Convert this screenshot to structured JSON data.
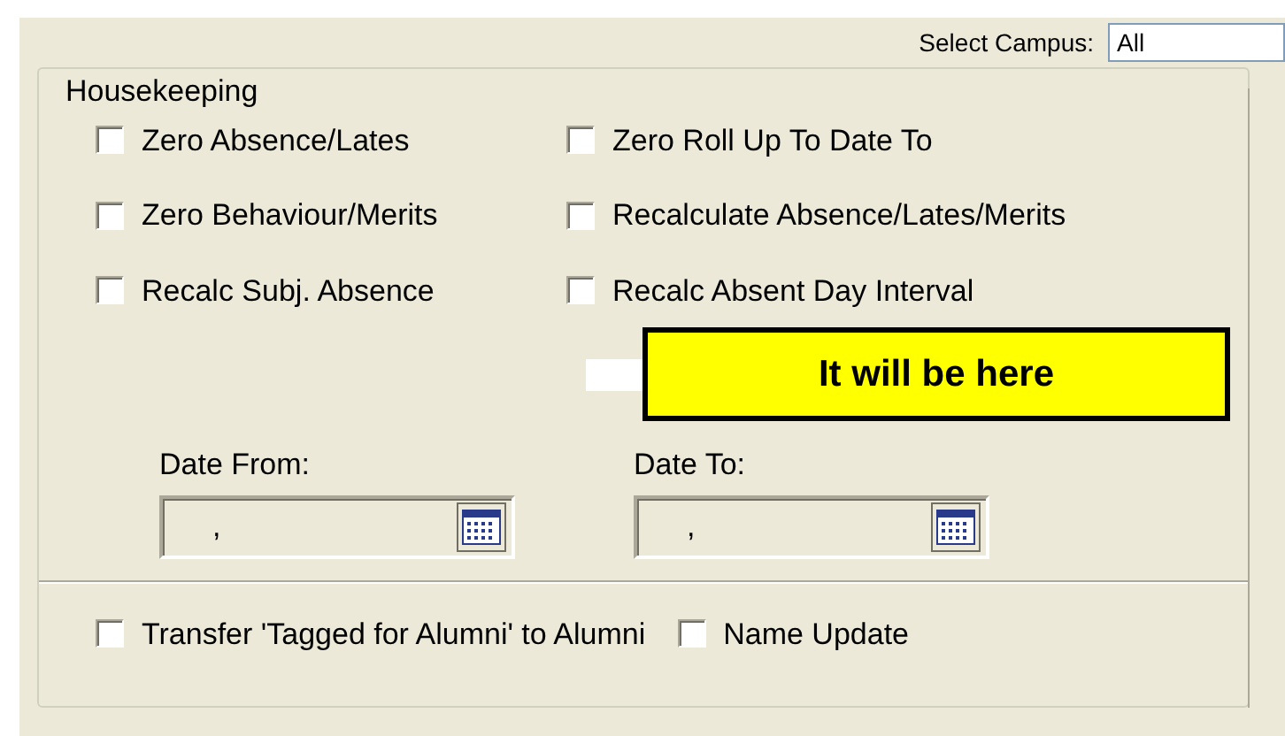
{
  "campus": {
    "label": "Select Campus:",
    "value": "All"
  },
  "group": {
    "title": "Housekeeping",
    "options": [
      {
        "label": "Zero Absence/Lates",
        "checked": false
      },
      {
        "label": "Zero Roll Up To Date To",
        "checked": false
      },
      {
        "label": "Zero Behaviour/Merits",
        "checked": false
      },
      {
        "label": "Recalculate Absence/Lates/Merits",
        "checked": false
      },
      {
        "label": "Recalc Subj. Absence",
        "checked": false
      },
      {
        "label": "Recalc Absent Day Interval",
        "checked": false
      }
    ],
    "callout": "It will be here",
    "dates": [
      {
        "label": "Date From:",
        "value": ","
      },
      {
        "label": "Date To:",
        "value": ","
      }
    ],
    "bottom_options": [
      {
        "label": "Transfer 'Tagged for Alumni' to Alumni",
        "checked": false
      },
      {
        "label": "Name Update",
        "checked": false
      }
    ]
  }
}
